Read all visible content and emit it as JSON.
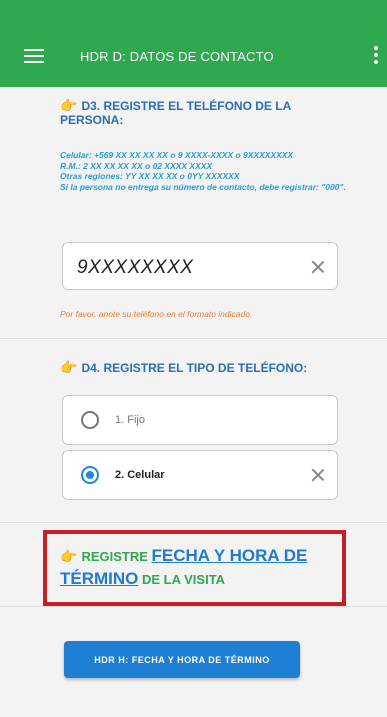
{
  "appbar": {
    "title": "HDR D: DATOS DE CONTACTO"
  },
  "d3": {
    "title": "D3. REGISTRE EL TELÉFONO DE LA PERSONA:",
    "help": [
      "Celular: +569 XX XX XX XX o 9 XXXX-XXXX o 9XXXXXXXX",
      "R.M.: 2 XX XX XX XX o 02 XXXX XXXX",
      "Otras regiones: YY XX XX XX o 0YY XXXXXX",
      "Si la persona no entrega su número de contacto, debe registrar: \"000\"."
    ],
    "phone_value": "9XXXXXXXX",
    "error": "Por favor, anote su teléfono en el formato indicado."
  },
  "d4": {
    "title": "D4. REGISTRE EL TIPO DE TELÉFONO:",
    "options": [
      {
        "label": "1. Fijo",
        "selected": false
      },
      {
        "label": "2. Celular",
        "selected": true
      }
    ]
  },
  "end": {
    "p1": "REGISTRE ",
    "p2": "FECHA Y HORA DE",
    "p3": "TÉRMINO",
    "p4": " DE LA VISITA"
  },
  "button": {
    "label": "HDR H: FECHA Y HORA DE TÉRMINO"
  },
  "colors": {
    "appbar": "#2fa84f",
    "accent": "#1e88e5",
    "highlight": "#c62026"
  }
}
